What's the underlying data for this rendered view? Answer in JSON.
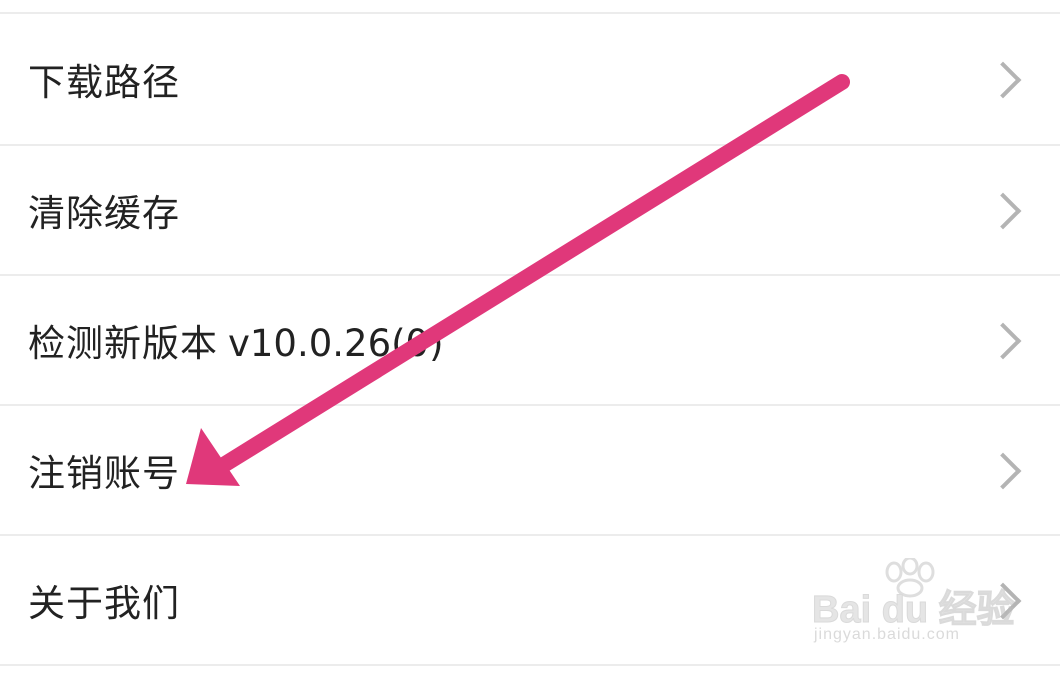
{
  "settings": {
    "items": [
      {
        "label": "下载路径"
      },
      {
        "label": "清除缓存"
      },
      {
        "label": "检测新版本",
        "version": "v10.0.26(0)"
      },
      {
        "label": "注销账号"
      },
      {
        "label": "关于我们"
      }
    ]
  },
  "watermark": {
    "brand": "Bai du 经验",
    "url": "jingyan.baidu.com"
  },
  "colors": {
    "arrow": "#e0387a",
    "divider": "#ececec",
    "chevron": "#b4b4b4",
    "text": "#222222"
  }
}
